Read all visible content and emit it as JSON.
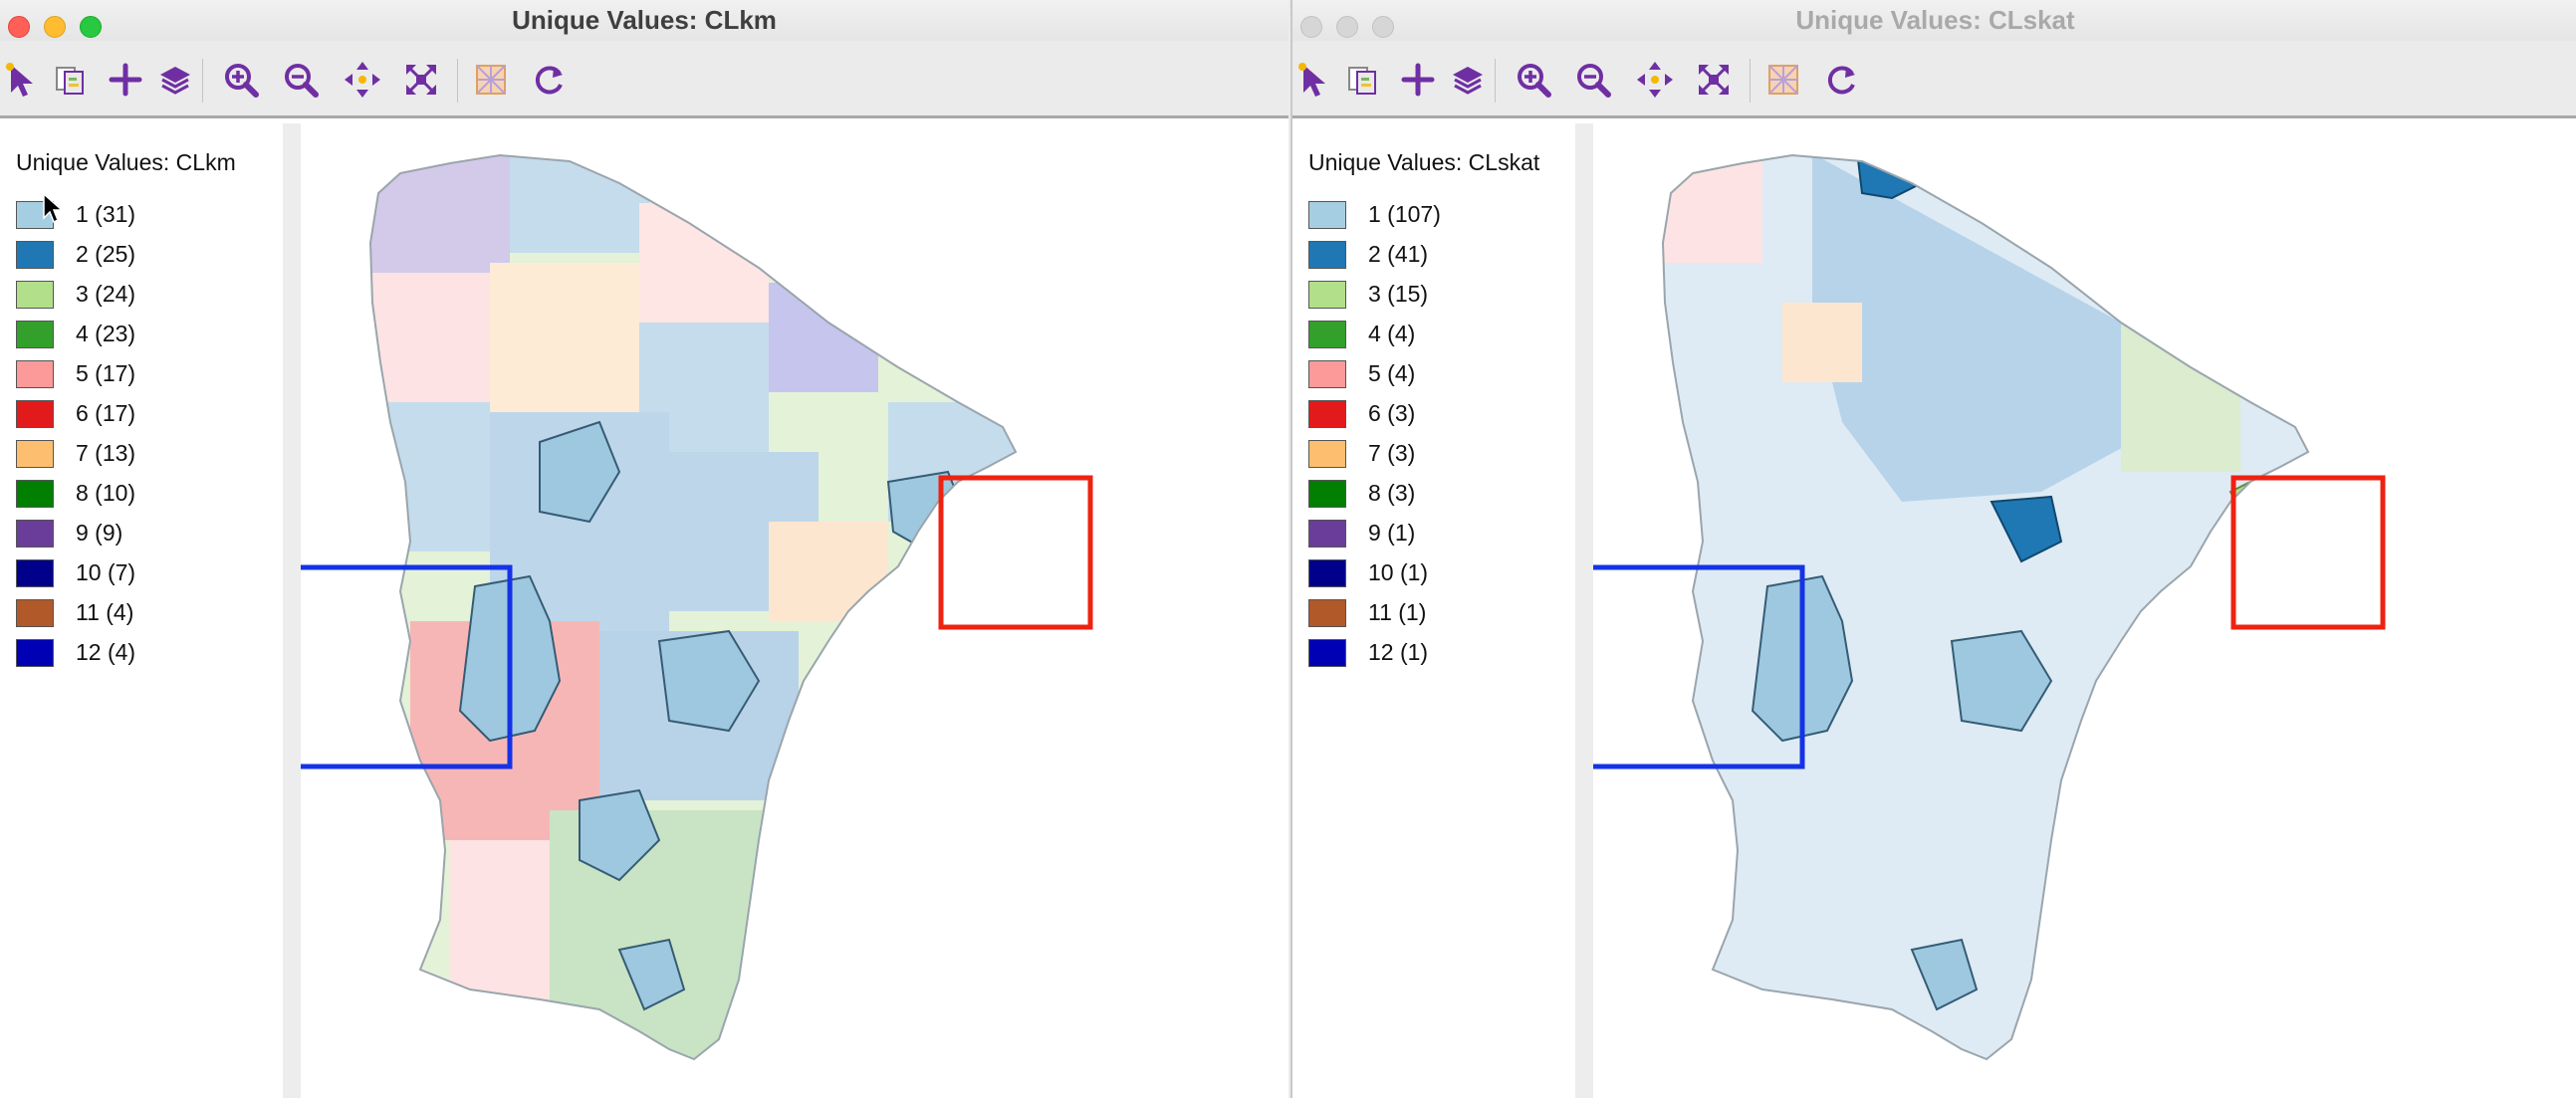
{
  "left_window": {
    "title": "Unique Values: CLkm",
    "legend_title": "Unique Values: CLkm",
    "legend": [
      {
        "label": "1 (31)",
        "color": "#a6cee3"
      },
      {
        "label": "2 (25)",
        "color": "#1f78b4"
      },
      {
        "label": "3 (24)",
        "color": "#b2df8a"
      },
      {
        "label": "4 (23)",
        "color": "#33a02c"
      },
      {
        "label": "5 (17)",
        "color": "#fb9a99"
      },
      {
        "label": "6 (17)",
        "color": "#e31a1c"
      },
      {
        "label": "7 (13)",
        "color": "#fdbf6f"
      },
      {
        "label": "8 (10)",
        "color": "#007f00"
      },
      {
        "label": "9 (9)",
        "color": "#6a3d9a"
      },
      {
        "label": "10 (7)",
        "color": "#00008b"
      },
      {
        "label": "11 (4)",
        "color": "#b15928"
      },
      {
        "label": "12 (4)",
        "color": "#0000b5"
      }
    ]
  },
  "right_window": {
    "title": "Unique Values: CLskat",
    "legend_title": "Unique Values: CLskat",
    "legend": [
      {
        "label": "1 (107)",
        "color": "#a6cee3"
      },
      {
        "label": "2 (41)",
        "color": "#1f78b4"
      },
      {
        "label": "3 (15)",
        "color": "#b2df8a"
      },
      {
        "label": "4 (4)",
        "color": "#33a02c"
      },
      {
        "label": "5 (4)",
        "color": "#fb9a99"
      },
      {
        "label": "6 (3)",
        "color": "#e31a1c"
      },
      {
        "label": "7 (3)",
        "color": "#fdbf6f"
      },
      {
        "label": "8 (3)",
        "color": "#007f00"
      },
      {
        "label": "9 (1)",
        "color": "#6a3d9a"
      },
      {
        "label": "10 (1)",
        "color": "#00008b"
      },
      {
        "label": "11 (1)",
        "color": "#b15928"
      },
      {
        "label": "12 (1)",
        "color": "#0000b5"
      }
    ]
  },
  "toolbar_icons": [
    "select-icon",
    "copy-selection-icon",
    "add-icon",
    "layers-icon",
    "zoom-in-icon",
    "zoom-out-icon",
    "pan-icon",
    "full-extent-icon",
    "map-background-icon",
    "refresh-icon"
  ],
  "highlight_box_colors": {
    "blue": "#1433e6",
    "red": "#ee2211"
  }
}
